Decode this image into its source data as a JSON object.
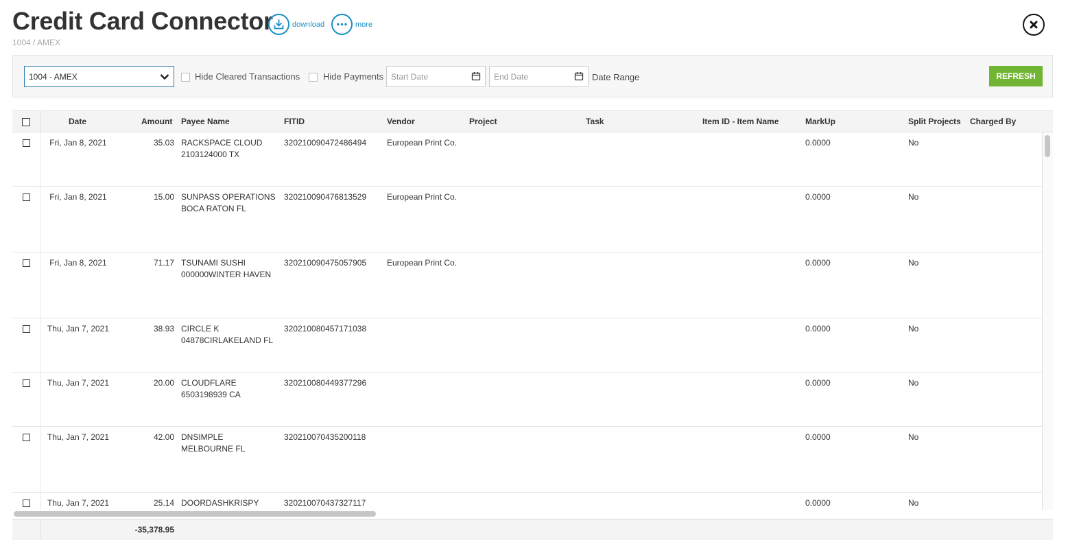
{
  "header": {
    "title": "Credit Card Connector",
    "breadcrumb": "1004 / AMEX",
    "download_label": "download",
    "more_label": "more"
  },
  "filters": {
    "account_value": "1004 - AMEX",
    "hide_cleared_label": "Hide Cleared Transactions",
    "hide_cleared_checked": false,
    "hide_payments_label": "Hide Payments",
    "hide_payments_checked": false,
    "start_date_placeholder": "Start Date",
    "end_date_placeholder": "End Date",
    "date_range_label": "Date Range",
    "refresh_label": "REFRESH"
  },
  "table": {
    "columns": {
      "date": "Date",
      "amount": "Amount",
      "payee": "Payee Name",
      "fitid": "FITID",
      "vendor": "Vendor",
      "project": "Project",
      "task": "Task",
      "item": "Item ID - Item Name",
      "markup": "MarkUp",
      "split": "Split Projects",
      "charged_by": "Charged By"
    },
    "rows": [
      {
        "date": "Fri, Jan 8, 2021",
        "amount": "35.03",
        "payee": "RACKSPACE CLOUD 2103124000 TX",
        "fitid": "320210090472486494",
        "vendor": "European Print Co.",
        "markup": "0.0000",
        "split": "No"
      },
      {
        "date": "Fri, Jan 8, 2021",
        "amount": "15.00",
        "payee": "SUNPASS OPERATIONS BOCA RATON FL",
        "fitid": "320210090476813529",
        "vendor": "European Print Co.",
        "markup": "0.0000",
        "split": "No"
      },
      {
        "date": "Fri, Jan 8, 2021",
        "amount": "71.17",
        "payee": "TSUNAMI SUSHI 000000WINTER HAVEN",
        "fitid": "320210090475057905",
        "vendor": "European Print Co.",
        "markup": "0.0000",
        "split": "No"
      },
      {
        "date": "Thu, Jan 7, 2021",
        "amount": "38.93",
        "payee": "CIRCLE K 04878CIRLAKELAND FL",
        "fitid": "320210080457171038",
        "vendor": "",
        "markup": "0.0000",
        "split": "No"
      },
      {
        "date": "Thu, Jan 7, 2021",
        "amount": "20.00",
        "payee": "CLOUDFLARE 6503198939 CA",
        "fitid": "320210080449377296",
        "vendor": "",
        "markup": "0.0000",
        "split": "No"
      },
      {
        "date": "Thu, Jan 7, 2021",
        "amount": "42.00",
        "payee": "DNSIMPLE MELBOURNE FL",
        "fitid": "320210070435200118",
        "vendor": "",
        "markup": "0.0000",
        "split": "No"
      },
      {
        "date": "Thu, Jan 7, 2021",
        "amount": "25.14",
        "payee": "DOORDASHKRISPY",
        "fitid": "320210070437327117",
        "vendor": "",
        "markup": "0.0000",
        "split": "No"
      }
    ],
    "total": "-35,378.95"
  }
}
